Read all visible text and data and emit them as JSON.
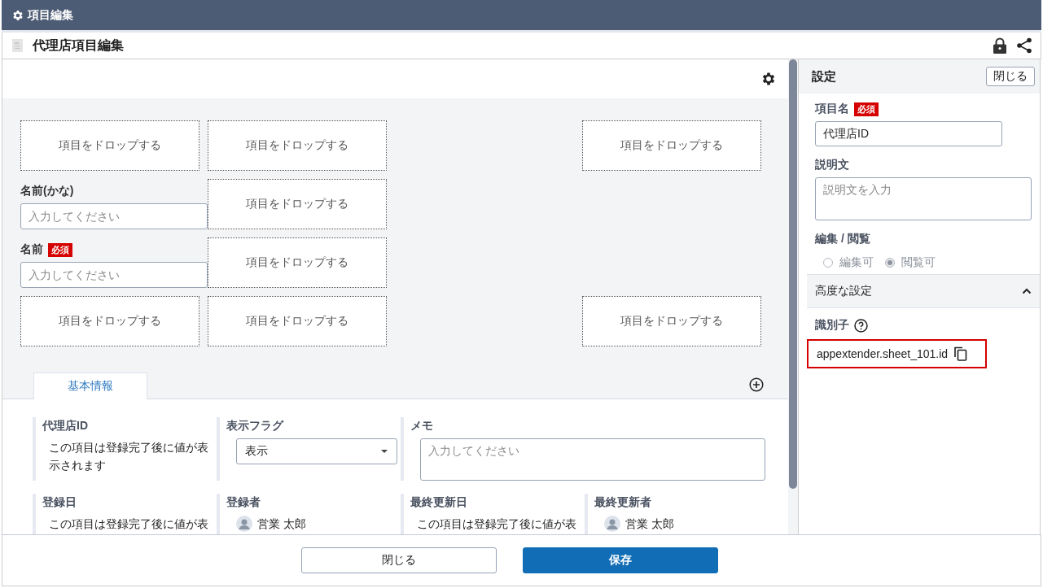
{
  "title_bar": {
    "title": "項目編集"
  },
  "header": {
    "title": "代理店項目編集"
  },
  "canvas": {
    "cells": [
      {
        "kind": "drop",
        "text": "項目をドロップする"
      },
      {
        "kind": "drop",
        "text": "項目をドロップする"
      },
      {
        "kind": "empty"
      },
      {
        "kind": "drop",
        "text": "項目をドロップする"
      },
      {
        "kind": "field",
        "label": "名前(かな)",
        "placeholder": "入力してください"
      },
      {
        "kind": "drop",
        "text": "項目をドロップする"
      },
      {
        "kind": "empty"
      },
      {
        "kind": "empty"
      },
      {
        "kind": "field",
        "label": "名前",
        "badge": "必須",
        "placeholder": "入力してください"
      },
      {
        "kind": "drop",
        "text": "項目をドロップする"
      },
      {
        "kind": "empty"
      },
      {
        "kind": "empty"
      },
      {
        "kind": "drop",
        "text": "項目をドロップする"
      },
      {
        "kind": "drop",
        "text": "項目をドロップする"
      },
      {
        "kind": "empty"
      },
      {
        "kind": "drop",
        "text": "項目をドロップする"
      }
    ]
  },
  "tabs": [
    {
      "label": "基本情報",
      "selected": true
    }
  ],
  "form": {
    "fields": [
      {
        "kind": "display",
        "label": "代理店ID",
        "value": "この項目は登録完了後に値が表示されます"
      },
      {
        "kind": "select",
        "label": "表示フラグ",
        "value": "表示"
      },
      {
        "kind": "textarea",
        "label": "メモ",
        "placeholder": "入力してください"
      },
      {
        "kind": "empty"
      },
      {
        "kind": "display",
        "label": "登録日",
        "value": "この項目は登録完了後に値が表"
      },
      {
        "kind": "user",
        "label": "登録者",
        "value": "営業 太郎"
      },
      {
        "kind": "display",
        "label": "最終更新日",
        "value": "この項目は登録完了後に値が表"
      },
      {
        "kind": "user",
        "label": "最終更新者",
        "value": "営業 太郎"
      }
    ]
  },
  "footer": {
    "buttons": [
      {
        "label": "閉じる",
        "kind": "secondary"
      },
      {
        "label": "保存",
        "kind": "primary"
      }
    ]
  },
  "settings": {
    "title": "設定",
    "close": "閉じる",
    "name_label": "項目名",
    "name_badge": "必須",
    "name_value": "代理店ID",
    "description_label": "説明文",
    "description_placeholder": "説明文を入力",
    "access_label": "編集 / 閲覧",
    "access_disabled": true,
    "access_options": [
      {
        "label": "編集可",
        "selected": false
      },
      {
        "label": "閲覧可",
        "selected": true
      }
    ],
    "advanced": {
      "title": "高度な設定",
      "expanded": true,
      "identifier_label": "識別子",
      "identifier": "appextender.sheet_101.id",
      "highlighted": true
    }
  }
}
